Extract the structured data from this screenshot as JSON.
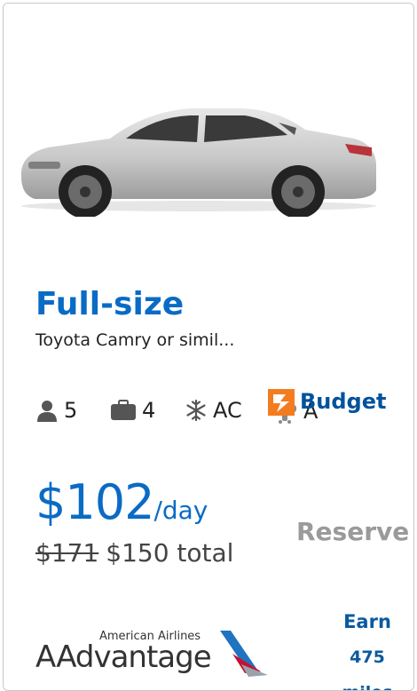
{
  "car": {
    "class": "Full-size",
    "model": "Toyota Camry or simil..."
  },
  "features": {
    "passengers": "5",
    "bags": "4",
    "ac": "AC",
    "transmission": "A"
  },
  "icons": [
    "person-icon",
    "suitcase-icon",
    "snowflake-icon",
    "transmission-icon"
  ],
  "vendor": {
    "name": "Budget"
  },
  "price": {
    "per_day": "$102",
    "per_day_unit": "/day",
    "old_total": "$171",
    "total": "$150 total"
  },
  "reserve_label": "Reserve",
  "loyalty": {
    "airline": "American Airlines",
    "program": "AAdvantage",
    "earn_line1": "Earn",
    "earn_line2": "475",
    "earn_line3": "miles"
  },
  "colors": {
    "accent": "#0a6bc5",
    "vendor_orange": "#f47c20",
    "vendor_blue": "#00529b",
    "reserve_text": "#9a9a9a",
    "aa_blue": "#0a5a9e"
  }
}
